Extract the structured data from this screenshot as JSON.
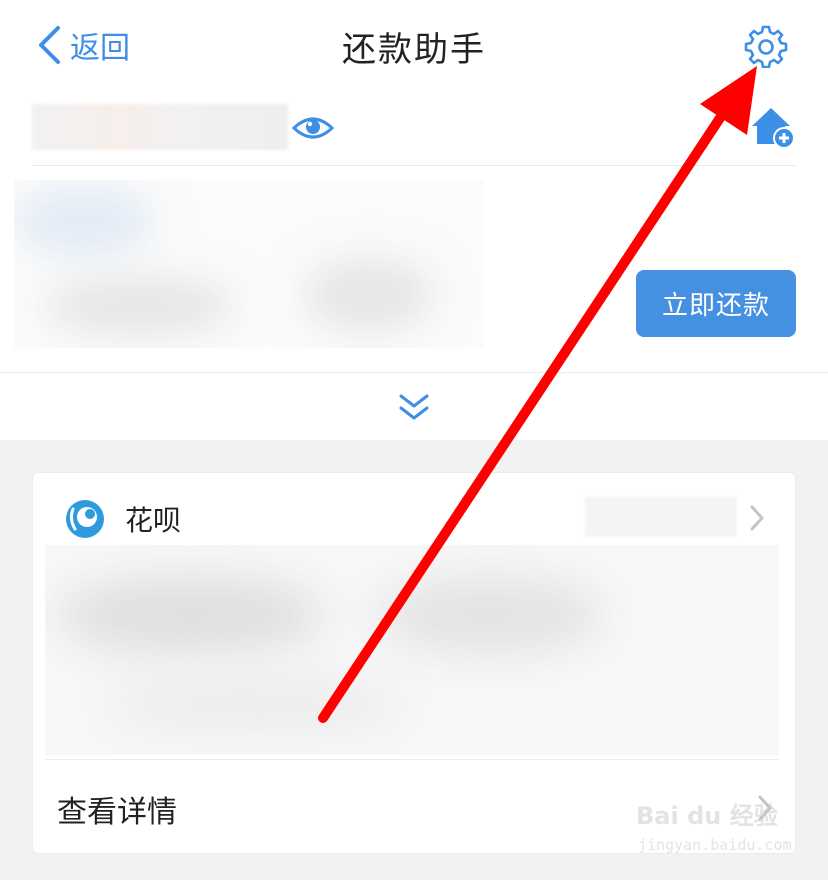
{
  "header": {
    "back_label": "返回",
    "title": "还款助手",
    "settings_icon": "gear-icon"
  },
  "account": {
    "eye_icon": "eye-icon",
    "home_add_icon": "home-add-icon"
  },
  "summary": {
    "pay_now_label": "立即还款",
    "expand_icon": "double-chevron-down-icon"
  },
  "card": {
    "logo_icon": "huabei-logo",
    "name": "花呗",
    "details_label": "查看详情"
  },
  "watermark": {
    "brand": "Bai du 经验",
    "url": "jingyan.baidu.com"
  },
  "colors": {
    "accent": "#4690e2",
    "link": "#3d8ee6",
    "annotation_arrow": "#ff0000"
  }
}
